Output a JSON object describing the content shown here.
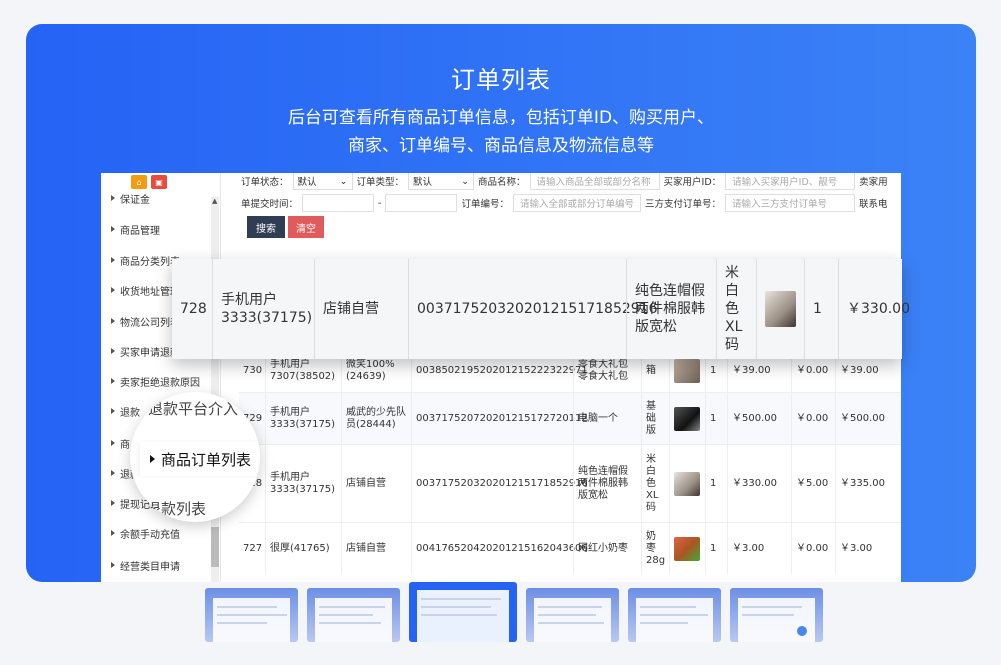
{
  "hero": {
    "title": "订单列表",
    "subtitle_line1": "后台可查看所有商品订单信息，包括订单ID、购买用户、",
    "subtitle_line2": "商家、订单编号、商品信息及物流信息等"
  },
  "sidebar": {
    "items": [
      "保证金",
      "商品管理",
      "商品分类列表",
      "收货地址管理",
      "物流公司列表",
      "买家申请退款原因",
      "卖家拒绝退款原因",
      "退款",
      "商",
      "退款",
      "提现记录",
      "余额手动充值",
      "经营类目申请"
    ]
  },
  "filters": {
    "order_status_label": "订单状态：",
    "order_status_value": "默认",
    "order_type_label": "订单类型：",
    "order_type_value": "默认",
    "product_name_label": "商品名称：",
    "product_name_placeholder": "请输入商品全部或部分名称",
    "buyer_id_label": "买家用户ID：",
    "buyer_id_placeholder": "请输入买家用户ID、靓号",
    "seller_label": "卖家用",
    "submit_time_label": "单提交时间：",
    "date_sep": "-",
    "order_no_label": "订单编号：",
    "order_no_placeholder": "请输入全部或部分订单编号",
    "third_pay_label": "三方支付订单号：",
    "third_pay_placeholder": "请输入三方支付订单号",
    "contact_label": "联系电",
    "search_label": "搜索",
    "clear_label": "清空"
  },
  "table_rows": [
    {
      "id": "730",
      "user": "手机用户7307(38502)",
      "shop": "微笑100%(24639)",
      "order_no": "003850219520201215222322971",
      "product": "零食大礼包零食大礼包",
      "spec": "箱",
      "qty": "1",
      "price": "￥39.00",
      "freight": "￥0.00",
      "total": "￥39.00"
    },
    {
      "id": "729",
      "user": "手机用户3333(37175)",
      "shop": "威武的少先队员(28444)",
      "order_no": "003717520720201215172720112",
      "product": "电脑一个",
      "spec": "基础版",
      "qty": "1",
      "price": "￥500.00",
      "freight": "￥0.00",
      "total": "￥500.00"
    },
    {
      "id": "728",
      "user": "手机用户3333(37175)",
      "shop": "店铺自营",
      "order_no": "003717520320201215171852916",
      "product": "纯色连帽假两件棉服韩版宽松",
      "spec": "米白色XL码",
      "qty": "1",
      "price": "￥330.00",
      "freight": "￥5.00",
      "total": "￥335.00"
    },
    {
      "id": "727",
      "user": "很厚(41765)",
      "shop": "店铺自营",
      "order_no": "004176520420201215162043606",
      "product": "网红小奶枣",
      "spec": "奶枣28g",
      "qty": "1",
      "price": "￥3.00",
      "freight": "￥0.00",
      "total": "￥3.00"
    }
  ],
  "zoom_row": {
    "id": "728",
    "user": "手机用户3333(37175)",
    "shop": "店铺自营",
    "order_no": "003717520320201215171852916",
    "product": "纯色连帽假两件棉服韩版宽松",
    "spec": "米白色XL码",
    "qty": "1",
    "price": "￥330.00"
  },
  "magnifier": {
    "item_above": "退款平台介入",
    "item_active": "商品订单列表",
    "item_below": "退款列表"
  },
  "colors": {
    "hero_start": "#2563f5",
    "hero_end": "#3b82f6",
    "search_button": "#2f3e52",
    "clear_button": "#e25b5b"
  }
}
